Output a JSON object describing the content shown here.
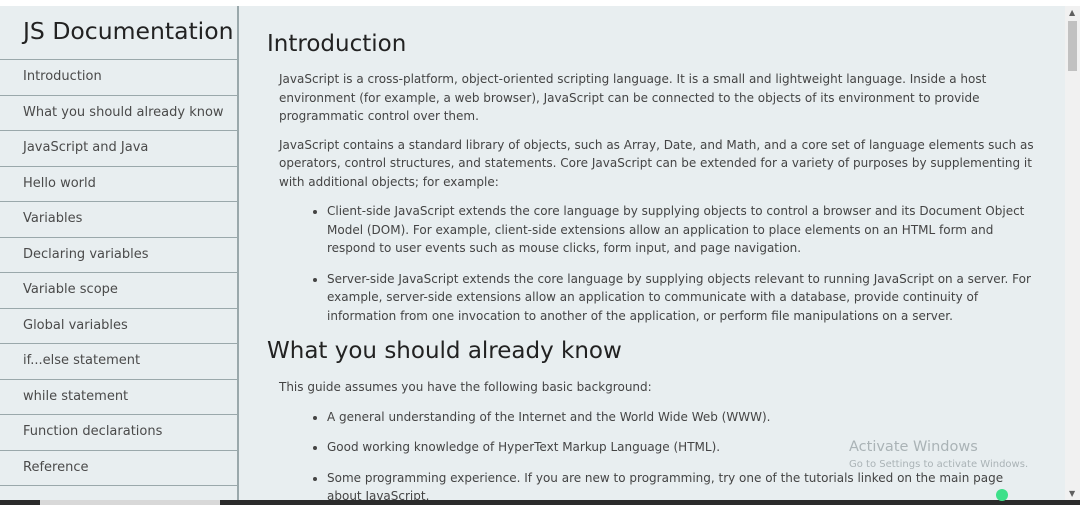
{
  "sidebar": {
    "title": "JS Documentation",
    "items": [
      {
        "label": "Introduction"
      },
      {
        "label": "What you should already know"
      },
      {
        "label": "JavaScript and Java"
      },
      {
        "label": "Hello world"
      },
      {
        "label": "Variables"
      },
      {
        "label": "Declaring variables"
      },
      {
        "label": "Variable scope"
      },
      {
        "label": "Global variables"
      },
      {
        "label": "if...else statement"
      },
      {
        "label": "while statement"
      },
      {
        "label": "Function declarations"
      },
      {
        "label": "Reference"
      }
    ]
  },
  "main": {
    "intro": {
      "title": "Introduction",
      "p1": "JavaScript is a cross-platform, object-oriented scripting language. It is a small and lightweight language. Inside a host environment (for example, a web browser), JavaScript can be connected to the objects of its environment to provide programmatic control over them.",
      "p2": "JavaScript contains a standard library of objects, such as Array, Date, and Math, and a core set of language elements such as operators, control structures, and statements. Core JavaScript can be extended for a variety of purposes by supplementing it with additional objects; for example:",
      "bullets": [
        "Client-side JavaScript extends the core language by supplying objects to control a browser and its Document Object Model (DOM). For example, client-side extensions allow an application to place elements on an HTML form and respond to user events such as mouse clicks, form input, and page navigation.",
        "Server-side JavaScript extends the core language by supplying objects relevant to running JavaScript on a server. For example, server-side extensions allow an application to communicate with a database, provide continuity of information from one invocation to another of the application, or perform file manipulations on a server."
      ]
    },
    "know": {
      "title": "What you should already know",
      "p1": "This guide assumes you have the following basic background:",
      "bullets": [
        "A general understanding of the Internet and the World Wide Web (WWW).",
        "Good working knowledge of HyperText Markup Language (HTML).",
        "Some programming experience. If you are new to programming, try one of the tutorials linked on the main page about JavaScript."
      ]
    }
  },
  "watermark": {
    "title": "Activate Windows",
    "subtitle": "Go to Settings to activate Windows."
  },
  "colors": {
    "background": "#e8eef0",
    "divider": "#9aa8ab",
    "text": "#444444"
  }
}
